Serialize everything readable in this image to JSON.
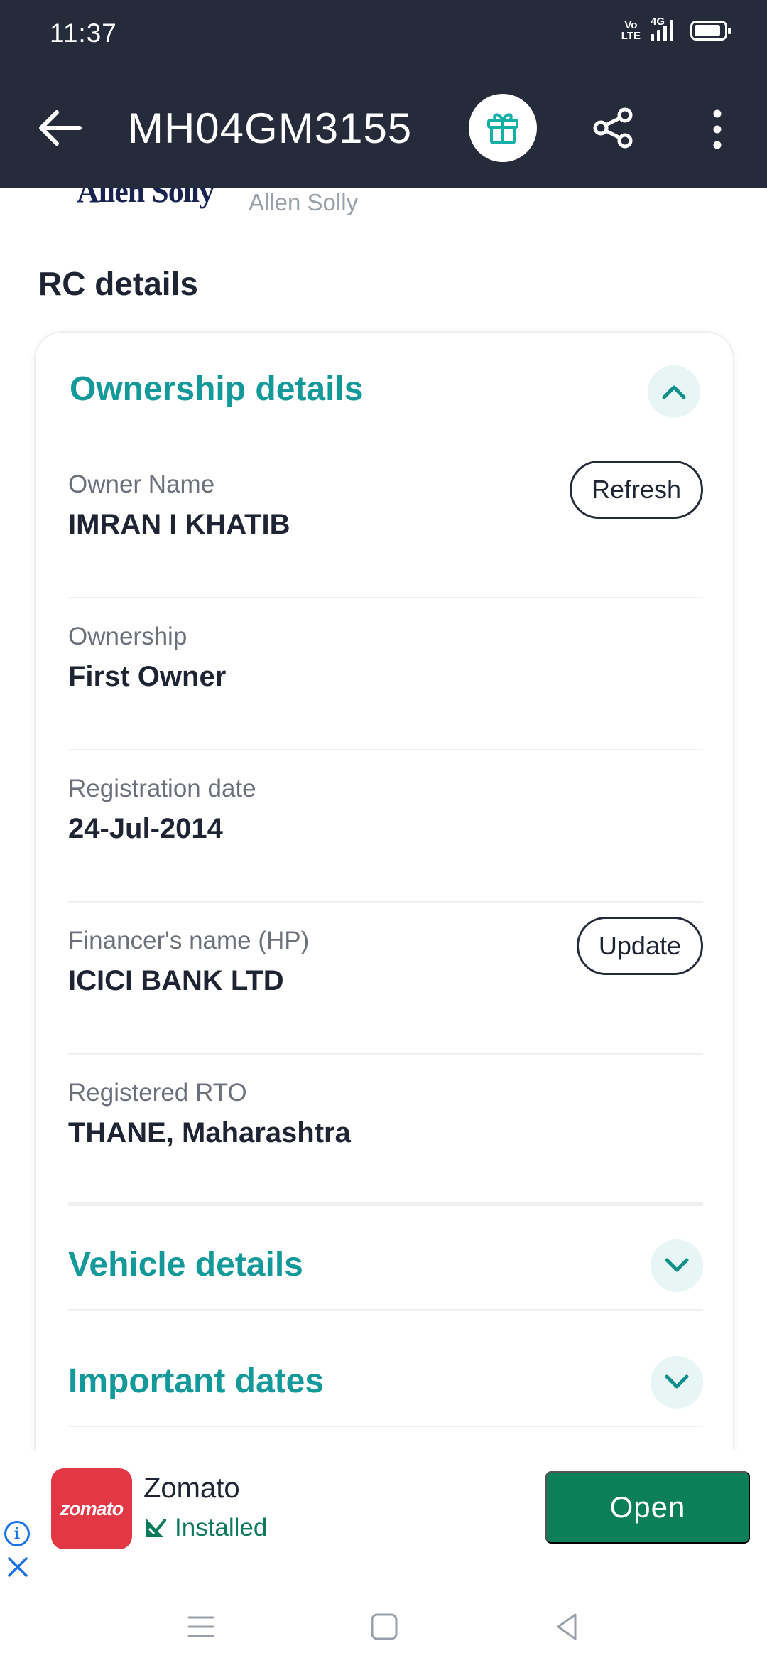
{
  "status_bar": {
    "time": "11:37",
    "volte": "Vo LTE",
    "network": "4G",
    "battery_level": 0.85
  },
  "app_bar": {
    "title": "MH04GM3155",
    "back_icon": "arrow-left-icon",
    "gift_icon": "gift-icon",
    "share_icon": "share-icon",
    "more_icon": "more-vert-icon"
  },
  "brand": {
    "logo_text": "Allen Solly",
    "name": "Allen Solly"
  },
  "section_title": "RC details",
  "ownership": {
    "heading": "Ownership details",
    "expanded": true,
    "rows": [
      {
        "label": "Owner Name",
        "value": "IMRAN I KHATIB",
        "action": "Refresh"
      },
      {
        "label": "Ownership",
        "value": "First Owner"
      },
      {
        "label": "Registration date",
        "value": "24-Jul-2014"
      },
      {
        "label": "Financer's name (HP)",
        "value": "ICICI BANK LTD",
        "action": "Update"
      },
      {
        "label": "Registered RTO",
        "value": "THANE, Maharashtra"
      }
    ]
  },
  "collapsed_sections": [
    {
      "heading": "Vehicle details"
    },
    {
      "heading": "Important dates"
    }
  ],
  "ad": {
    "logo_text": "zomato",
    "app_name": "Zomato",
    "status": "Installed",
    "button": "Open",
    "colors": {
      "logo_bg": "#e23744",
      "button_bg": "#0b7f58"
    }
  },
  "colors": {
    "header_bg": "#252b3b",
    "accent": "#13999a",
    "chevron_bg": "#e7f6f5"
  }
}
